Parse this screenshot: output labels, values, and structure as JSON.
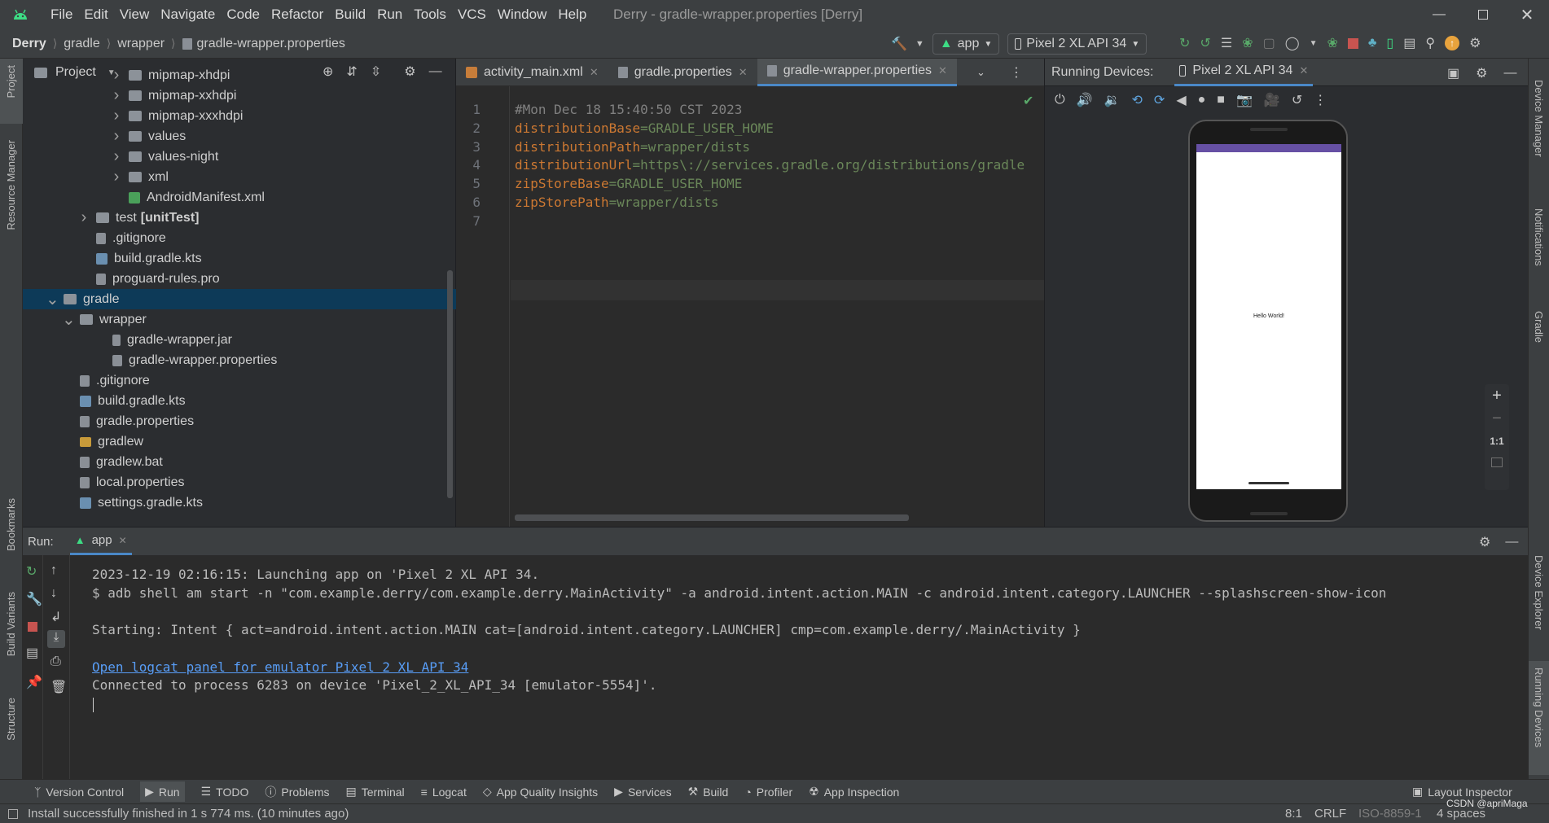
{
  "window": {
    "title": "Derry - gradle-wrapper.properties [Derry]",
    "menu": [
      "File",
      "Edit",
      "View",
      "Navigate",
      "Code",
      "Refactor",
      "Build",
      "Run",
      "Tools",
      "VCS",
      "Window",
      "Help"
    ]
  },
  "breadcrumb": [
    "Derry",
    "gradle",
    "wrapper",
    "gradle-wrapper.properties"
  ],
  "toolbar": {
    "run_config": "app",
    "device": "Pixel 2 XL API 34"
  },
  "project_panel": {
    "title": "Project",
    "tree": [
      {
        "label": "mipmap-xhdpi",
        "type": "folder",
        "level": 5,
        "expandable": true
      },
      {
        "label": "mipmap-xxhdpi",
        "type": "folder",
        "level": 5,
        "expandable": true
      },
      {
        "label": "mipmap-xxxhdpi",
        "type": "folder",
        "level": 5,
        "expandable": true
      },
      {
        "label": "values",
        "type": "folder",
        "level": 5,
        "expandable": true
      },
      {
        "label": "values-night",
        "type": "folder",
        "level": 5,
        "expandable": true
      },
      {
        "label": "xml",
        "type": "folder",
        "level": 5,
        "expandable": true
      },
      {
        "label": "AndroidManifest.xml",
        "type": "manifest",
        "level": 5,
        "expandable": false
      },
      {
        "label": "test",
        "suffix": "[unitTest]",
        "type": "folder",
        "level": 3,
        "expandable": true
      },
      {
        "label": ".gitignore",
        "type": "file",
        "level": 3,
        "expandable": false
      },
      {
        "label": "build.gradle.kts",
        "type": "gradle",
        "level": 3,
        "expandable": false
      },
      {
        "label": "proguard-rules.pro",
        "type": "file",
        "level": 3,
        "expandable": false
      },
      {
        "label": "gradle",
        "type": "folder",
        "level": 1,
        "expanded": true,
        "selected": true
      },
      {
        "label": "wrapper",
        "type": "folder",
        "level": 2,
        "expanded": true
      },
      {
        "label": "gradle-wrapper.jar",
        "type": "jar",
        "level": 4,
        "expandable": false
      },
      {
        "label": "gradle-wrapper.properties",
        "type": "properties",
        "level": 4,
        "expandable": false
      },
      {
        "label": ".gitignore",
        "type": "file",
        "level": 2,
        "expandable": false
      },
      {
        "label": "build.gradle.kts",
        "type": "gradle",
        "level": 2,
        "expandable": false
      },
      {
        "label": "gradle.properties",
        "type": "properties",
        "level": 2,
        "expandable": false
      },
      {
        "label": "gradlew",
        "type": "script",
        "level": 2,
        "expandable": false
      },
      {
        "label": "gradlew.bat",
        "type": "file",
        "level": 2,
        "expandable": false
      },
      {
        "label": "local.properties",
        "type": "properties",
        "level": 2,
        "expandable": false
      },
      {
        "label": "settings.gradle.kts",
        "type": "gradle",
        "level": 2,
        "expandable": false
      }
    ]
  },
  "editor": {
    "tabs": [
      {
        "label": "activity_main.xml",
        "active": false
      },
      {
        "label": "gradle.properties",
        "active": false
      },
      {
        "label": "gradle-wrapper.properties",
        "active": true
      }
    ],
    "lines": [
      {
        "n": "1",
        "parts": [
          {
            "t": "#Mon Dec 18 15:40:50 CST 2023",
            "c": "c"
          }
        ]
      },
      {
        "n": "2",
        "parts": [
          {
            "t": "distributionBase",
            "c": "k"
          },
          {
            "t": "=GRADLE_USER_HOME",
            "c": "v"
          }
        ]
      },
      {
        "n": "3",
        "parts": [
          {
            "t": "distributionPath",
            "c": "k"
          },
          {
            "t": "=wrapper/dists",
            "c": "v"
          }
        ]
      },
      {
        "n": "4",
        "parts": [
          {
            "t": "distributionUrl",
            "c": "k"
          },
          {
            "t": "=https\\://services.gradle.org/distributions/gradle",
            "c": "v"
          }
        ]
      },
      {
        "n": "5",
        "parts": [
          {
            "t": "zipStoreBase",
            "c": "k"
          },
          {
            "t": "=GRADLE_USER_HOME",
            "c": "v"
          }
        ]
      },
      {
        "n": "6",
        "parts": [
          {
            "t": "zipStorePath",
            "c": "k"
          },
          {
            "t": "=wrapper/dists",
            "c": "v"
          }
        ]
      },
      {
        "n": "7",
        "parts": []
      }
    ]
  },
  "devices_panel": {
    "title": "Running Devices:",
    "device_tab": "Pixel 2 XL API 34",
    "screen_text": "Hello World!",
    "zoom_controls": [
      "+",
      "−",
      "1:1"
    ]
  },
  "run_panel": {
    "label": "Run:",
    "tab": "app",
    "console": [
      {
        "text": "2023-12-19 02:16:15: Launching app on 'Pixel 2 XL API 34.",
        "link": false
      },
      {
        "text": "$ adb shell am start -n \"com.example.derry/com.example.derry.MainActivity\" -a android.intent.action.MAIN -c android.intent.category.LAUNCHER --splashscreen-show-icon",
        "link": false
      },
      {
        "text": "",
        "link": false
      },
      {
        "text": "Starting: Intent { act=android.intent.action.MAIN cat=[android.intent.category.LAUNCHER] cmp=com.example.derry/.MainActivity }",
        "link": false
      },
      {
        "text": "",
        "link": false
      },
      {
        "text": "Open logcat panel for emulator Pixel 2 XL API 34",
        "link": true
      },
      {
        "text": "Connected to process 6283 on device 'Pixel_2_XL_API_34 [emulator-5554]'.",
        "link": false
      }
    ]
  },
  "bottom_tools": [
    "Version Control",
    "Run",
    "TODO",
    "Problems",
    "Terminal",
    "Logcat",
    "App Quality Insights",
    "Services",
    "Build",
    "Profiler",
    "App Inspection"
  ],
  "layout_inspector": "Layout Inspector",
  "left_strip": [
    "Project",
    "Resource Manager",
    "Bookmarks",
    "Build Variants",
    "Structure"
  ],
  "right_strip": [
    "Device Manager",
    "Notifications",
    "Gradle",
    "Device Explorer",
    "Running Devices"
  ],
  "status": {
    "message": "Install successfully finished in 1 s 774 ms. (10 minutes ago)",
    "position": "8:1",
    "line_sep": "CRLF",
    "encoding": "ISO-8859-1",
    "indent": "4 spaces",
    "watermark": "CSDN @apriMaga"
  },
  "colors": {
    "accent": "#4a88c7",
    "selection": "#0d3a58",
    "android_green": "#3ddc84"
  }
}
